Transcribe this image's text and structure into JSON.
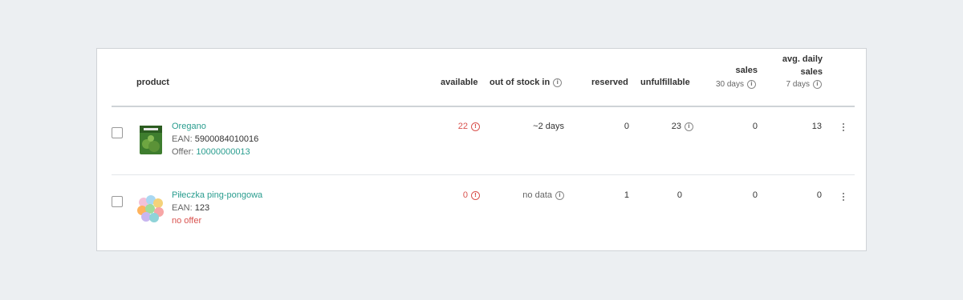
{
  "columns": {
    "product": "product",
    "available": "available",
    "out_of_stock_in": "out of stock in",
    "reserved": "reserved",
    "unfulfillable": "unfulfillable",
    "sales": "sales",
    "sales_period": "30 days",
    "avg_daily_sales_line1": "avg. daily",
    "avg_daily_sales_line2": "sales",
    "avg_daily_period": "7 days"
  },
  "rows": [
    {
      "name": "Oregano",
      "ean_label": "EAN:",
      "ean": "5900084010016",
      "offer_label": "Offer:",
      "offer": "10000000013",
      "available": "22",
      "out_of_stock_in": "~2 days",
      "reserved": "0",
      "unfulfillable": "23",
      "sales": "0",
      "avg_daily_sales": "13"
    },
    {
      "name": "Piłeczka ping-pongowa",
      "ean_label": "EAN:",
      "ean": "123",
      "offer_text": "no offer",
      "available": "0",
      "out_of_stock_in": "no data",
      "reserved": "1",
      "unfulfillable": "0",
      "sales": "0",
      "avg_daily_sales": "0"
    }
  ],
  "colors": {
    "link": "#2a9d8f",
    "alert": "#d9534f",
    "background": "#eceff2"
  },
  "icons": [
    "info-icon",
    "more-vertical-icon",
    "checkbox"
  ]
}
